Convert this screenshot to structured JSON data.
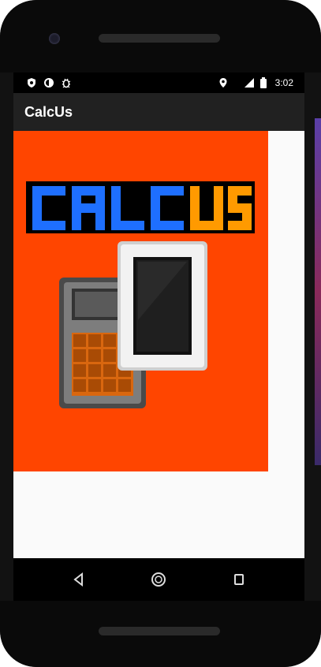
{
  "status_bar": {
    "time": "3:02",
    "icons": [
      "shield-icon",
      "sync-icon",
      "bug-icon",
      "location-icon",
      "signal-icon",
      "battery-icon"
    ]
  },
  "app_bar": {
    "title": "CalcUs"
  },
  "splash": {
    "logo_text_blue": "CALC",
    "logo_text_orange": "US",
    "colors": {
      "background": "#ff4500",
      "blue": "#1e6fff",
      "orange": "#ff9a00",
      "calculator_body": "#7d7d7d",
      "phone_frame": "#f2f2f2",
      "phone_screen": "#111111"
    }
  },
  "nav_bar": {
    "buttons": [
      "back-icon",
      "home-icon",
      "recents-icon"
    ]
  }
}
